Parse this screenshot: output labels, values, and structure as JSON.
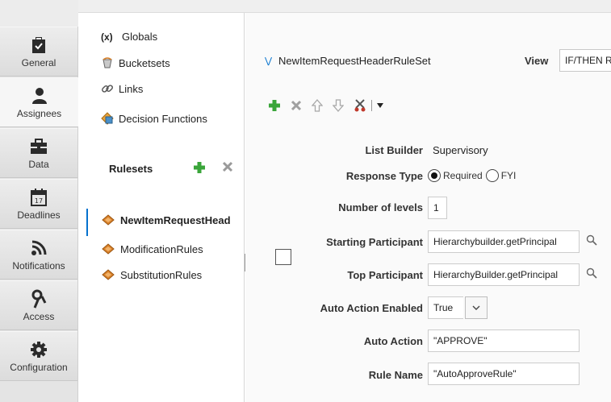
{
  "nav": {
    "items": [
      {
        "label": "General",
        "icon": "clipboard-check-icon"
      },
      {
        "label": "Assignees",
        "icon": "user-icon"
      },
      {
        "label": "Data",
        "icon": "briefcase-icon"
      },
      {
        "label": "Deadlines",
        "icon": "calendar-icon"
      },
      {
        "label": "Notifications",
        "icon": "rss-icon"
      },
      {
        "label": "Access",
        "icon": "access-icon"
      },
      {
        "label": "Configuration",
        "icon": "gear-icon"
      }
    ],
    "active": "Assignees"
  },
  "tree": {
    "items": [
      {
        "label": "Globals",
        "icon": "variable-icon",
        "prefix": "(x)"
      },
      {
        "label": "Bucketsets",
        "icon": "bucketset-icon"
      },
      {
        "label": "Links",
        "icon": "link-icon"
      },
      {
        "label": "Decision Functions",
        "icon": "decision-function-icon"
      }
    ],
    "rulesets_title": "Rulesets",
    "rulesets": [
      {
        "label": "NewItemRequestHead",
        "selected": true
      },
      {
        "label": "ModificationRules",
        "selected": false
      },
      {
        "label": "SubstitutionRules",
        "selected": false
      }
    ]
  },
  "content": {
    "ruleset_name": "NewItemRequestHeaderRuleSet",
    "view_label": "View",
    "view_value": "IF/THEN R",
    "form": {
      "list_builder": {
        "label": "List Builder",
        "value": "Supervisory"
      },
      "response_type": {
        "label": "Response Type",
        "options": [
          "Required",
          "FYI"
        ],
        "selected": "Required"
      },
      "number_of_levels": {
        "label": "Number of levels",
        "value": "1"
      },
      "starting_participant": {
        "label": "Starting Participant",
        "value": "Hierarchybuilder.getPrincipal"
      },
      "top_participant": {
        "label": "Top Participant",
        "value": "HierarchyBuilder.getPrincipal"
      },
      "auto_action_enabled": {
        "label": "Auto Action Enabled",
        "value": "True"
      },
      "auto_action": {
        "label": "Auto Action",
        "value": "\"APPROVE\""
      },
      "rule_name": {
        "label": "Rule Name",
        "value": "\"AutoApproveRule\""
      }
    }
  },
  "colors": {
    "accent": "#0572ce",
    "add_green": "#3aa53a",
    "delete_gray": "#9a9a9a",
    "cut_red": "#c0392b"
  }
}
